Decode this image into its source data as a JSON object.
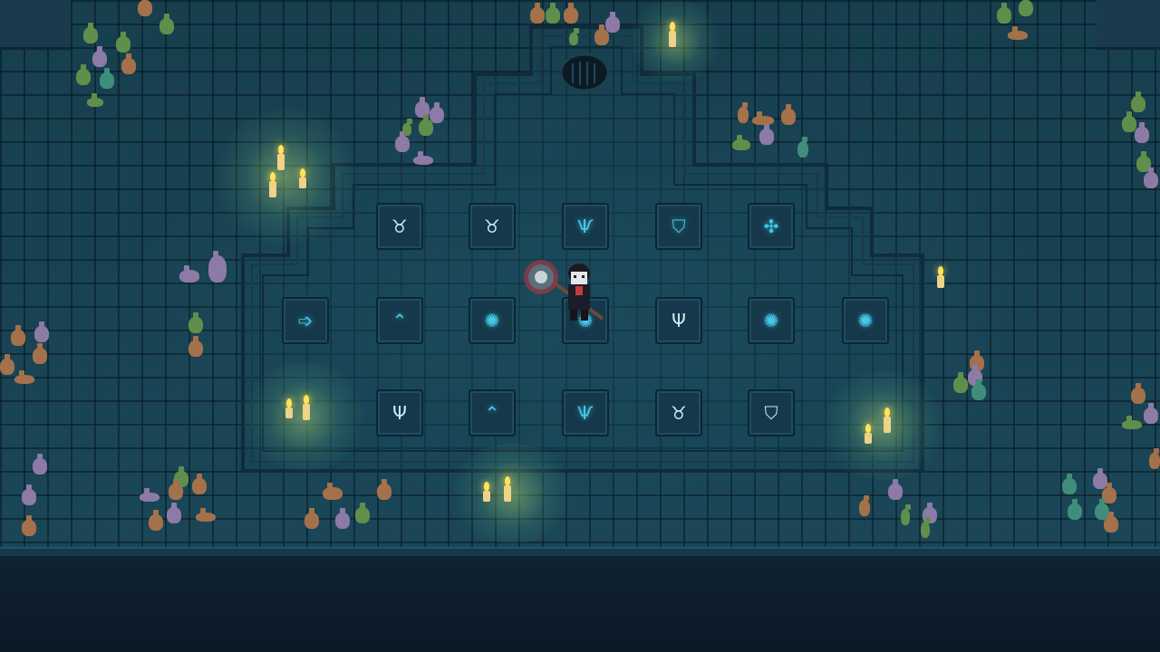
{
  "scene": {
    "description_type": "dungeon-room",
    "colors": {
      "floor": "#1b4a5c",
      "rune_glow": "#46c8ea",
      "candle_flame": "#ffe45a",
      "void": "#0c1c2c"
    }
  },
  "rune_tiles": [
    {
      "row": 1,
      "icon": "ox-skull-rune-icon",
      "glyph": "♉",
      "pale": true
    },
    {
      "row": 1,
      "icon": "ox-skull-rune-icon",
      "glyph": "♉",
      "pale": true
    },
    {
      "row": 1,
      "icon": "branch-rune-icon",
      "glyph": "Ѱ",
      "pale": false
    },
    {
      "row": 1,
      "icon": "eye-shield-rune-icon",
      "glyph": "⛉",
      "pale": false
    },
    {
      "row": 1,
      "icon": "tree-rune-icon",
      "glyph": "✣",
      "pale": false
    },
    {
      "row": 2,
      "icon": "arrow-right-rune-icon",
      "glyph": "➩",
      "pale": false
    },
    {
      "row": 2,
      "icon": "chevron-up-rune-icon",
      "glyph": "⌃",
      "pale": false
    },
    {
      "row": 2,
      "icon": "sun-rune-icon",
      "glyph": "✺",
      "pale": false
    },
    {
      "row": 2,
      "icon": "sun-rune-icon",
      "glyph": "✺",
      "pale": false
    },
    {
      "row": 2,
      "icon": "trident-rune-icon",
      "glyph": "Ψ",
      "pale": true
    },
    {
      "row": 2,
      "icon": "sun-rune-icon",
      "glyph": "✺",
      "pale": false
    },
    {
      "row": 2,
      "icon": "sun-rune-icon",
      "glyph": "✺",
      "pale": false
    },
    {
      "row": 3,
      "icon": "trident-rune-icon",
      "glyph": "Ψ",
      "pale": true
    },
    {
      "row": 3,
      "icon": "chevron-up-rune-icon",
      "glyph": "⌃",
      "pale": false
    },
    {
      "row": 3,
      "icon": "branch-rune-icon",
      "glyph": "Ѱ",
      "pale": false
    },
    {
      "row": 3,
      "icon": "ox-skull-rune-icon",
      "glyph": "♉",
      "pale": true
    },
    {
      "row": 3,
      "icon": "eye-shield-rune-icon",
      "glyph": "⛉",
      "pale": true
    }
  ],
  "player": {
    "name_icon": "vampire-hero-icon",
    "weapon_icon": "battle-axe-icon"
  }
}
